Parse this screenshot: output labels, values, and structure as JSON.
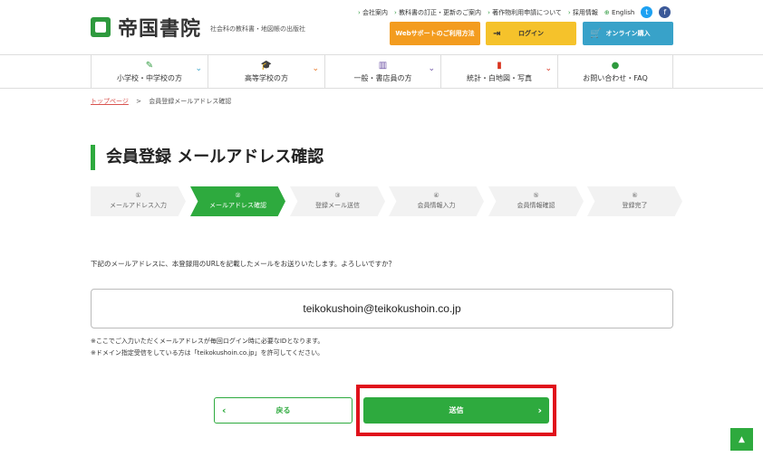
{
  "header": {
    "logo_text": "帝国書院",
    "logo_sub": "社会科の教科書・地図帳の出版社",
    "toplinks": [
      "会社案内",
      "教科書の訂正・更新のご案内",
      "著作物利用申請について",
      "採用情報"
    ],
    "lang": "English",
    "btn_web": "Webサポートのご利用方法",
    "btn_login": "ログイン",
    "btn_shop": "オンライン購入",
    "colors": {
      "green": "#2eaa3e",
      "orange": "#f39c1f",
      "yellow": "#f5c22b",
      "blue": "#38a2c9"
    }
  },
  "nav": [
    {
      "label": "小学校・中学校の方",
      "icon": "pencil-icon"
    },
    {
      "label": "高等学校の方",
      "icon": "graduation-cap-icon"
    },
    {
      "label": "一般・書店員の方",
      "icon": "book-icon"
    },
    {
      "label": "統計・白地図・写真",
      "icon": "stats-icon"
    },
    {
      "label": "お問い合わせ・FAQ",
      "icon": "speech-bubble-icon"
    }
  ],
  "breadcrumb": {
    "home": "トップページ",
    "sep": ">",
    "current": "会員登録メールアドレス確認"
  },
  "page_title": "会員登録 メールアドレス確認",
  "steps": [
    {
      "num": "①",
      "label": "メールアドレス入力"
    },
    {
      "num": "②",
      "label": "メールアドレス確認"
    },
    {
      "num": "③",
      "label": "登録メール送信"
    },
    {
      "num": "④",
      "label": "会員情報入力"
    },
    {
      "num": "⑤",
      "label": "会員情報確認"
    },
    {
      "num": "⑥",
      "label": "登録完了"
    }
  ],
  "active_step": 2,
  "description": "下記のメールアドレスに、本登録用のURLを記載したメールをお送りいたします。よろしいですか？",
  "email": "teikokushoin@teikokushoin.co.jp",
  "notes": [
    "※ここでご入力いただくメールアドレスが毎回ログイン時に必要なIDとなります。",
    "※ドメイン指定受信をしている方は「teikokushoin.co.jp」を許可してください。"
  ],
  "buttons": {
    "back": "戻る",
    "send": "送信"
  },
  "to_top": "▲"
}
